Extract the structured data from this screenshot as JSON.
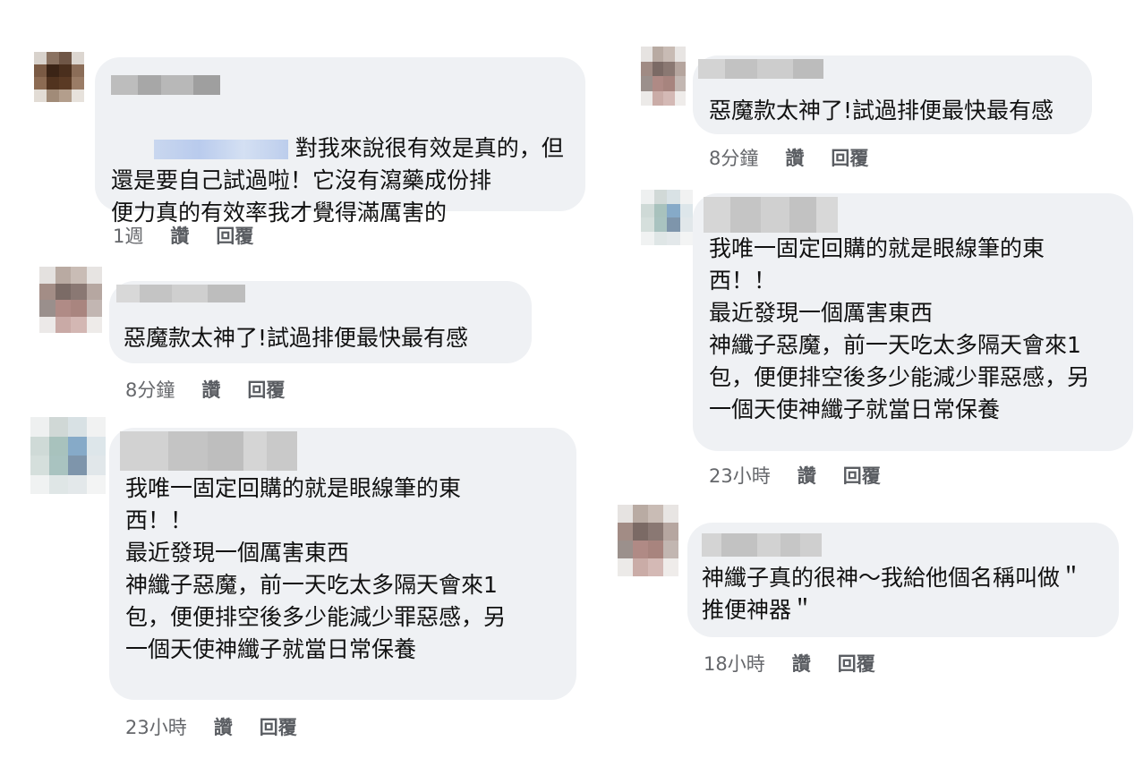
{
  "comments": [
    {
      "text": "對我來說很有效是真的，但\n還是要自己試過啦！它沒有瀉藥成份排\n便力真的有效率我才覺得滿厲害的",
      "time": "1週",
      "like": "讚",
      "reply": "回覆"
    },
    {
      "text": "惡魔款太神了!試過排便最快最有感",
      "time": "8分鐘",
      "like": "讚",
      "reply": "回覆"
    },
    {
      "text": "我唯一固定回購的就是眼線筆的東\n西！！\n最近發現一個厲害東西\n神纖子惡魔，前一天吃太多隔天會來1\n包，便便排空後多少能減少罪惡感，另\n一個天使神纖子就當日常保養",
      "time": "23小時",
      "like": "讚",
      "reply": "回覆"
    },
    {
      "text": "惡魔款太神了!試過排便最快最有感",
      "time": "8分鐘",
      "like": "讚",
      "reply": "回覆"
    },
    {
      "text": "我唯一固定回購的就是眼線筆的東\n西！！\n最近發現一個厲害東西\n神纖子惡魔，前一天吃太多隔天會來1\n包，便便排空後多少能減少罪惡感，另\n一個天使神纖子就當日常保養",
      "time": "23小時",
      "like": "讚",
      "reply": "回覆"
    },
    {
      "text": "神纖子真的很神～我給他個名稱叫做＂\n推便神器＂",
      "time": "18小時",
      "like": "讚",
      "reply": "回覆"
    }
  ],
  "colors": {
    "bubble": "#eff1f4",
    "text": "#111111",
    "action": "#5a5d62",
    "tag_blur": "#c9d7ef"
  }
}
